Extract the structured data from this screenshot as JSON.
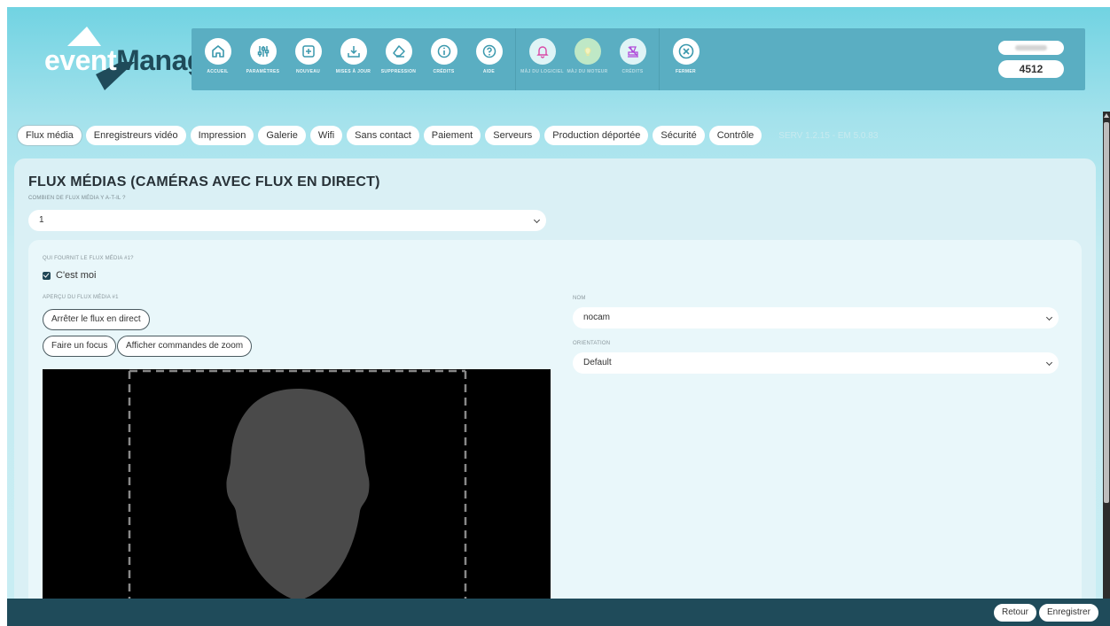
{
  "app": {
    "logo_prefix": "event",
    "logo_suffix": "Manager"
  },
  "toolbar": {
    "primary": [
      {
        "name": "home-button",
        "icon": "home-icon",
        "label": "ACCUEIL"
      },
      {
        "name": "settings-button",
        "icon": "sliders-icon",
        "label": "PARAMÈTRES"
      },
      {
        "name": "new-button",
        "icon": "plus-square-icon",
        "label": "NOUVEAU"
      },
      {
        "name": "updates-button",
        "icon": "download-icon",
        "label": "MISES À JOUR"
      },
      {
        "name": "delete-button",
        "icon": "eraser-icon",
        "label": "SUPPRESSION"
      },
      {
        "name": "credits-info-button",
        "icon": "info-icon",
        "label": "CRÉDITS"
      },
      {
        "name": "help-button",
        "icon": "help-icon",
        "label": "AIDE"
      }
    ],
    "secondary": [
      {
        "name": "notifications-button",
        "icon": "bell-icon",
        "label": "MÀJ DU LOGICIEL"
      },
      {
        "name": "bulb-button",
        "icon": "bulb-icon",
        "label": "MÀJ DU MOTEUR"
      },
      {
        "name": "credits-button",
        "icon": "stamp-icon",
        "label": "CRÉDITS"
      }
    ],
    "close": {
      "name": "close-button",
      "icon": "close-icon",
      "label": "FERMER"
    }
  },
  "user": {
    "code": "4512"
  },
  "tabs": [
    "Flux média",
    "Enregistreurs vidéo",
    "Impression",
    "Galerie",
    "Wifi",
    "Sans contact",
    "Paiement",
    "Serveurs",
    "Production déportée",
    "Sécurité",
    "Contrôle"
  ],
  "version": "SERV 1.2.15 - EM 5.0.83",
  "main": {
    "title": "FLUX MÉDIAS (CAMÉRAS AVEC FLUX EN DIRECT)",
    "count_label": "COMBIEN DE FLUX MÉDIA Y A-T-IL ?",
    "count_value": "1"
  },
  "stream": {
    "provider_label": "QUI FOURNIT LE FLUX MÉDIA #1?",
    "provider_checkbox": "C'est moi",
    "preview_label": "APERÇU DU FLUX MÉDIA #1",
    "stop_button": "Arrêter le flux en direct",
    "focus_button": "Faire un focus",
    "zoom_button": "Afficher commandes de zoom",
    "name_label": "NOM",
    "name_value": "nocam",
    "orientation_label": "ORIENTATION",
    "orientation_value": "Default"
  },
  "footer": {
    "back": "Retour",
    "save": "Enregistrer"
  },
  "colors": {
    "header_bg": "#71d3e2",
    "toolbar_bg": "#5aaec2",
    "footer_bg": "#1f4b5a",
    "card_bg": "#daf0f5",
    "accent_dark": "#1f4656"
  }
}
